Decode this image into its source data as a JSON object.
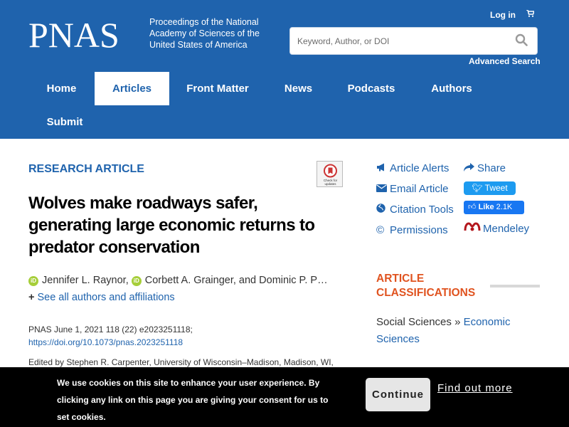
{
  "header": {
    "logo": "PNAS",
    "tagline": "Proceedings of the National Academy of Sciences of the United States of America",
    "login": "Log in",
    "search_placeholder": "Keyword, Author, or DOI",
    "advanced_search": "Advanced Search",
    "brand_color": "#1f63ad"
  },
  "nav": {
    "items": [
      {
        "label": "Home"
      },
      {
        "label": "Articles",
        "active": true
      },
      {
        "label": "Front Matter"
      },
      {
        "label": "News"
      },
      {
        "label": "Podcasts"
      },
      {
        "label": "Authors"
      },
      {
        "label": "Submit"
      }
    ]
  },
  "article": {
    "type": "RESEARCH ARTICLE",
    "badge": "Check for updates",
    "title": "Wolves make roadways safer, generating large economic returns to predator conservation",
    "authors": [
      {
        "name": "Jennifer L. Raynor",
        "orcid": true,
        "sep": ","
      },
      {
        "name": "Corbett A. Grainger",
        "orcid": true,
        "sep": ", and"
      },
      {
        "name": "Dominic P. P…",
        "orcid": false,
        "sep": ""
      }
    ],
    "see_all": "See all authors and affiliations",
    "citation": "PNAS June 1, 2021 118 (22) e2023251118;",
    "doi": "https://doi.org/10.1073/pnas.2023251118",
    "edited_by": "Edited by Stephen R. Carpenter, University of Wisconsin–Madison, Madison, WI,"
  },
  "tools": {
    "article_alerts": "Article Alerts",
    "email_article": "Email Article",
    "citation_tools": "Citation Tools",
    "permissions": "Permissions",
    "share": "Share",
    "tweet": "Tweet",
    "like": "Like",
    "like_count": "2.1K",
    "mendeley": "Mendeley"
  },
  "classifications": {
    "title": "ARTICLE CLASSIFICATIONS",
    "category": "Social Sciences",
    "separator": "»",
    "subcategory": "Economic Sciences",
    "accent_color": "#e0531f"
  },
  "cookie": {
    "message": "We use cookies on this site to enhance your user experience. By clicking any link on this page you are giving your consent for us to set cookies.",
    "continue": "Continue",
    "find_out_more": "Find out more"
  }
}
